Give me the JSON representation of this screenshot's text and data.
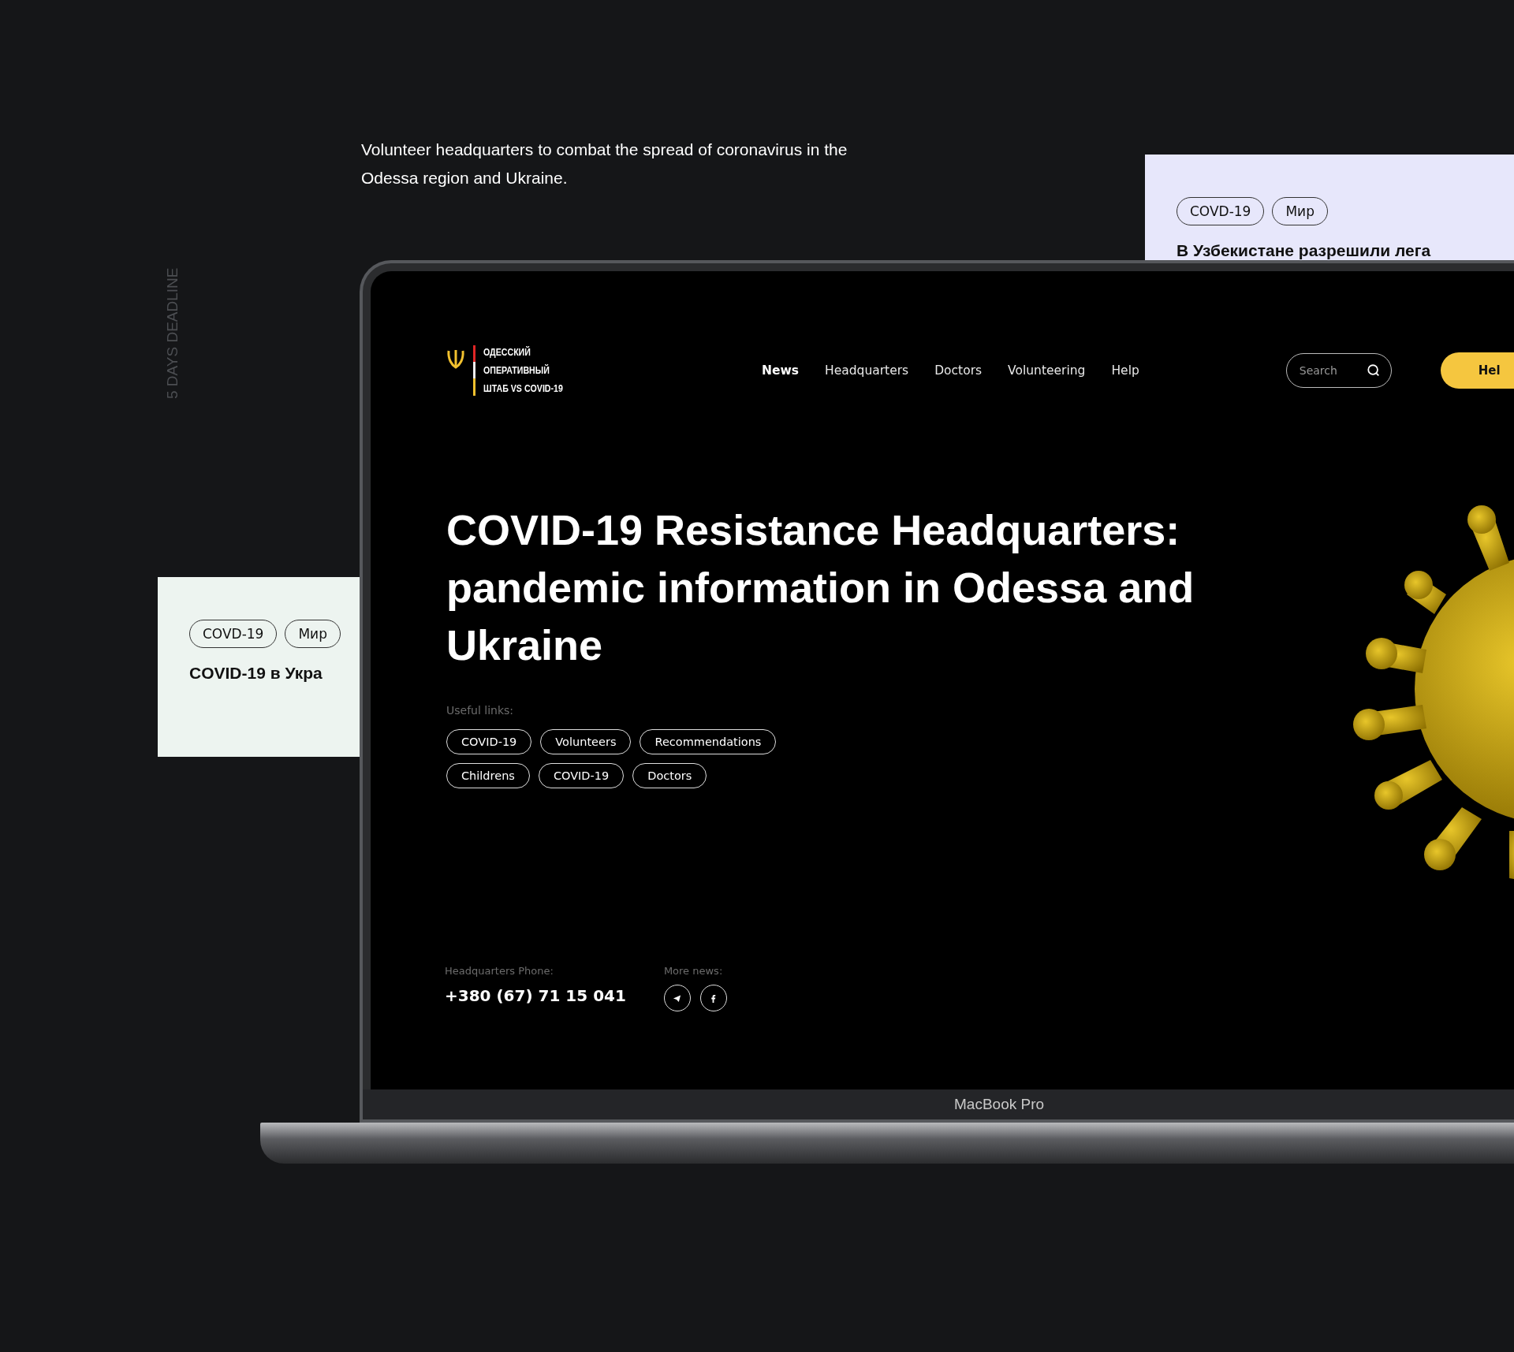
{
  "intro": "Volunteer headquarters to combat the spread of coronavirus in the Odessa region and Ukraine.",
  "side_label": "5 DAYS DEADLINE",
  "card_right": {
    "tags": [
      "COVD-19",
      "Мир"
    ],
    "title": "В Узбекистане разрешили лега"
  },
  "card_left": {
    "tags": [
      "COVD-19",
      "Мир"
    ],
    "title": "COVID-19 в Укра"
  },
  "site": {
    "logo": [
      "ОДЕССКИЙ",
      "ОПЕРАТИВНЫЙ",
      "ШТАБ VS COVID-19"
    ],
    "nav": [
      {
        "label": "News",
        "selected": true
      },
      {
        "label": "Headquarters",
        "selected": false
      },
      {
        "label": "Doctors",
        "selected": false
      },
      {
        "label": "Volunteering",
        "selected": false
      },
      {
        "label": "Help",
        "selected": false
      }
    ],
    "search": {
      "placeholder": "Search"
    },
    "help_button": "Hel",
    "headline": "COVID-19 Resistance Headquarters: pandemic information in Odessa and Ukraine",
    "useful_links_label": "Useful links:",
    "useful_links": [
      [
        "COVID-19",
        "Volunteers",
        "Recommendations"
      ],
      [
        "Childrens",
        "COVID-19",
        "Doctors"
      ]
    ],
    "phone_label": "Headquarters Phone:",
    "phone": "+380 (67) 71 15 041",
    "more_news_label": "More news:",
    "social": [
      {
        "kind": "telegram"
      },
      {
        "kind": "facebook"
      }
    ]
  },
  "device_label": "MacBook Pro"
}
